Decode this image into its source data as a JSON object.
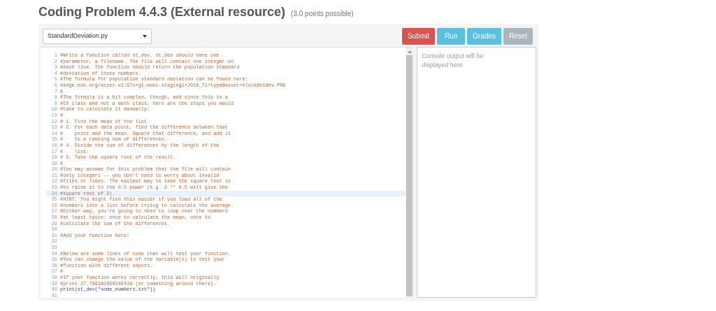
{
  "title": "Coding Problem 4.4.3 (External resource)",
  "points": "(3.0 points possible)",
  "file_select": {
    "value": "StandardDeviation.py"
  },
  "buttons": [
    {
      "label": "Submit",
      "kind": "submit"
    },
    {
      "label": "Run",
      "kind": "action"
    },
    {
      "label": "Grades",
      "kind": "action"
    },
    {
      "label": "Reset",
      "kind": "reset"
    }
  ],
  "editor": {
    "lines": [
      {
        "number": "1",
        "text": "#Write a function called st_dev. st_dev should have one",
        "kind": "comment",
        "selected": false
      },
      {
        "number": "2",
        "text": "#parameter, a filename. The file will contain one integer on",
        "kind": "comment",
        "selected": false
      },
      {
        "number": "3",
        "text": "#each line. The function should return the population standard",
        "kind": "comment",
        "selected": false
      },
      {
        "number": "4",
        "text": "#deviation of those numbers.",
        "kind": "comment",
        "selected": false
      },
      {
        "number": "5",
        "text": "#The formula for population standard deviation can be found here:",
        "kind": "comment",
        "selected": false
      },
      {
        "number": "6",
        "text": "#edge.edx.org/asset-v1:GTx+gt-mooc-staging1+2018_T1+type@asset+block@stdev.PNG",
        "kind": "comment",
        "selected": false
      },
      {
        "number": "7",
        "text": "#",
        "kind": "comment",
        "selected": false
      },
      {
        "number": "8",
        "text": "#The formula is a bit complex, though, and since this is a",
        "kind": "comment",
        "selected": false
      },
      {
        "number": "9",
        "text": "#CS class and not a math class, here are the steps you would",
        "kind": "comment",
        "selected": false
      },
      {
        "number": "10",
        "text": "#take to calculate it manually:",
        "kind": "comment",
        "selected": false
      },
      {
        "number": "11",
        "text": "#",
        "kind": "comment",
        "selected": false
      },
      {
        "number": "12",
        "text": "# 1. Find the mean of the list.",
        "kind": "comment",
        "selected": false
      },
      {
        "number": "13",
        "text": "# 2. For each data point, find the difference between that",
        "kind": "comment",
        "selected": false
      },
      {
        "number": "14",
        "text": "#    point and the mean. Square that difference, and add it",
        "kind": "comment",
        "selected": false
      },
      {
        "number": "15",
        "text": "#    to a running sum of differences.",
        "kind": "comment",
        "selected": false
      },
      {
        "number": "16",
        "text": "# 4. Divide the sum of differences by the length of the",
        "kind": "comment",
        "selected": false
      },
      {
        "number": "17",
        "text": "#    list.",
        "kind": "comment",
        "selected": false
      },
      {
        "number": "18",
        "text": "# 5. Take the square root of the result.",
        "kind": "comment",
        "selected": false
      },
      {
        "number": "19",
        "text": "#",
        "kind": "comment",
        "selected": false
      },
      {
        "number": "20",
        "text": "#You may assume for this problem that the file will contain",
        "kind": "comment",
        "selected": false
      },
      {
        "number": "21",
        "text": "#only integers -- you don't need to worry about invalid",
        "kind": "comment",
        "selected": false
      },
      {
        "number": "22",
        "text": "#files or lines. The easiest way to take the square root is",
        "kind": "comment",
        "selected": false
      },
      {
        "number": "23",
        "text": "#to raise it to the 0.5 power (e.g. 2 ** 0.5 will give the",
        "kind": "comment",
        "selected": false
      },
      {
        "number": "24",
        "text": "#square root of 2).",
        "kind": "comment",
        "selected": true
      },
      {
        "number": "25",
        "text": "#HINT: You might find this easier if you load all of the",
        "kind": "comment",
        "selected": false
      },
      {
        "number": "26",
        "text": "#numbers into a list before trying to calculate the average.",
        "kind": "comment",
        "selected": false
      },
      {
        "number": "27",
        "text": "#Either way, you're going to need to loop over the numbers",
        "kind": "comment",
        "selected": false
      },
      {
        "number": "28",
        "text": "#at least twice: once to calculate the mean, once to",
        "kind": "comment",
        "selected": false
      },
      {
        "number": "29",
        "text": "#calculate the sum of the differences.",
        "kind": "comment",
        "selected": false
      },
      {
        "number": "30",
        "selected": false
      },
      {
        "number": "31",
        "text": "#Add your function here!",
        "kind": "comment",
        "selected": false
      },
      {
        "number": "32",
        "selected": false
      },
      {
        "number": "33",
        "selected": false
      },
      {
        "number": "34",
        "text": "#Below are some lines of code that will test your function.",
        "kind": "comment",
        "selected": false
      },
      {
        "number": "35",
        "text": "#You can change the value of the variable(s) to test your",
        "kind": "comment",
        "selected": false
      },
      {
        "number": "36",
        "text": "#function with different inputs.",
        "kind": "comment",
        "selected": false
      },
      {
        "number": "37",
        "text": "#",
        "kind": "comment",
        "selected": false
      },
      {
        "number": "38",
        "text": "#If your function works correctly, this will originally",
        "kind": "comment",
        "selected": false
      },
      {
        "number": "39",
        "text": "#print 27.796382658340438 (or something around there).",
        "kind": "comment",
        "selected": false
      },
      {
        "number": "40",
        "text": "print(st_dev(\"some_numbers.txt\"))",
        "kind": "code",
        "selected": false
      },
      {
        "number": "41",
        "selected": false
      }
    ]
  },
  "console": {
    "placeholder": "Console output will be displayed here"
  }
}
